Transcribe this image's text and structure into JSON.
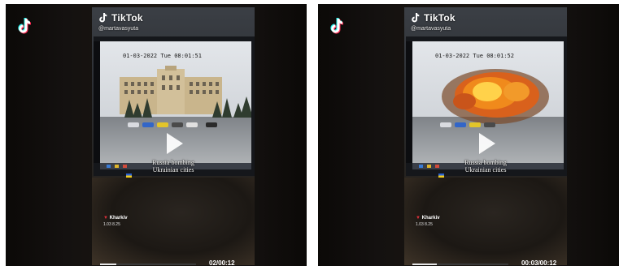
{
  "colors": {
    "panel_bg": "#0c0a08",
    "tiktok_red": "#fe2c55",
    "tiktok_cyan": "#25f4ee",
    "progress_fill": "#e8e8e8",
    "pin": "#e0303a"
  },
  "icons": {
    "app": "tiktok-logo-icon",
    "play": "play-icon",
    "pin": "location-pin-icon"
  },
  "panels": [
    {
      "brand": "TikTok",
      "username": "@martavasyuta",
      "cam_timestamp": "01-03-2022 Tue 08:01:51",
      "caption_line1": "Russia bombing",
      "caption_line2": "Ukrainian cities",
      "location_name": "Kharkiv",
      "location_date": "1.03 8.25",
      "time": "02/00:12",
      "progress": 0.17
    },
    {
      "brand": "TikTok",
      "username": "@martavasyuta",
      "cam_timestamp": "01-03-2022 Tue 08:01:52",
      "caption_line1": "Russia bombing",
      "caption_line2": "Ukrainian cities",
      "location_name": "Kharkiv",
      "location_date": "1.03 8.25",
      "time": "00:03/00:12",
      "progress": 0.25
    }
  ]
}
